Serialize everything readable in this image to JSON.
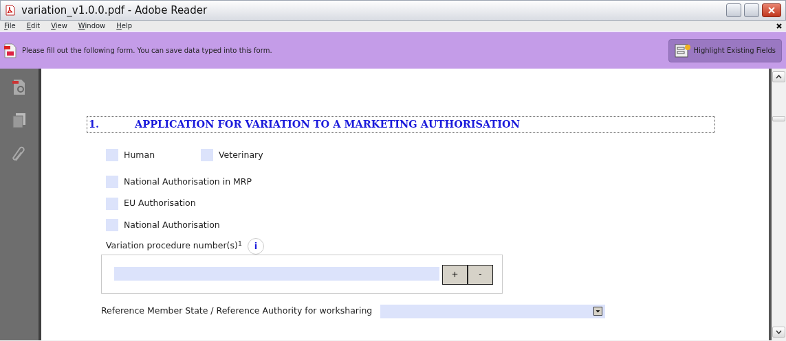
{
  "window": {
    "title": "variation_v1.0.0.pdf - Adobe Reader"
  },
  "menu": [
    "File",
    "Edit",
    "View",
    "Window",
    "Help"
  ],
  "form_bar": {
    "message": "Please fill out the following form. You can save data typed into this form.",
    "button": "Highlight Existing Fields"
  },
  "document": {
    "heading_number": "1.",
    "heading": "APPLICATION FOR VARIATION TO A MARKETING AUTHORISATION",
    "type_checkboxes": [
      {
        "label": "Human",
        "checked": false
      },
      {
        "label": "Veterinary",
        "checked": false
      }
    ],
    "authorisation_checkboxes": [
      {
        "label": "National Authorisation in MRP",
        "checked": false
      },
      {
        "label": "EU Authorisation",
        "checked": false
      },
      {
        "label": "National Authorisation",
        "checked": false
      }
    ],
    "procedure_label": "Variation procedure number(s)$^{1}$",
    "info_button": "i",
    "add_button": "+",
    "remove_button": "-",
    "reference_label": "Reference Member State / Reference Authority for worksharing"
  }
}
